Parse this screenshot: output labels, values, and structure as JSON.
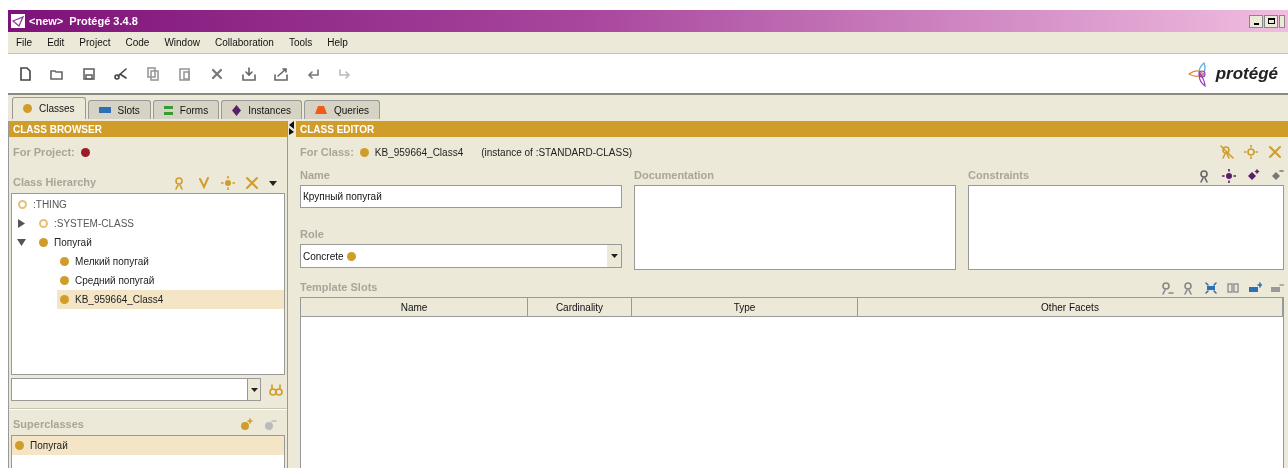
{
  "window": {
    "title": "<new>  Protégé 3.4.8"
  },
  "menu": [
    {
      "label": "File"
    },
    {
      "label": "Edit"
    },
    {
      "label": "Project"
    },
    {
      "label": "Code"
    },
    {
      "label": "Window"
    },
    {
      "label": "Collaboration"
    },
    {
      "label": "Tools"
    },
    {
      "label": "Help"
    }
  ],
  "logo": {
    "text": "protégé"
  },
  "tabs": [
    {
      "label": "Classes",
      "kind": "class",
      "selected": true
    },
    {
      "label": "Slots",
      "kind": "slot",
      "selected": false
    },
    {
      "label": "Forms",
      "kind": "form",
      "selected": false
    },
    {
      "label": "Instances",
      "kind": "instance",
      "selected": false
    },
    {
      "label": "Queries",
      "kind": "query",
      "selected": false
    }
  ],
  "class_browser": {
    "title": "CLASS BROWSER",
    "for_project_label": "For Project:",
    "hierarchy_label": "Class Hierarchy",
    "tree": [
      {
        "label": ":THING",
        "kind": "system",
        "selected": false
      },
      {
        "label": ":SYSTEM-CLASS",
        "kind": "system",
        "expanded": false,
        "selected": false
      },
      {
        "label": "Попугай",
        "kind": "class",
        "expanded": true,
        "selected": false,
        "children": [
          {
            "label": "Мелкий попугай",
            "kind": "class",
            "selected": false
          },
          {
            "label": "Средний попугай",
            "kind": "class",
            "selected": false
          },
          {
            "label": "KB_959664_Class4",
            "kind": "class",
            "selected": true
          }
        ]
      }
    ],
    "superclasses_label": "Superclasses",
    "superclasses": [
      {
        "label": "Попугай",
        "selected": true
      }
    ]
  },
  "class_editor": {
    "title": "CLASS EDITOR",
    "for_class_label": "For Class:",
    "class_name": "KB_959664_Class4",
    "instance_of": "(instance of :STANDARD-CLASS)",
    "name_label": "Name",
    "name_value": "Крупный попугай",
    "role_label": "Role",
    "role_value": "Concrete",
    "documentation_label": "Documentation",
    "constraints_label": "Constraints",
    "template_slots_label": "Template Slots",
    "columns": [
      "Name",
      "Cardinality",
      "Type",
      "Other Facets"
    ]
  }
}
